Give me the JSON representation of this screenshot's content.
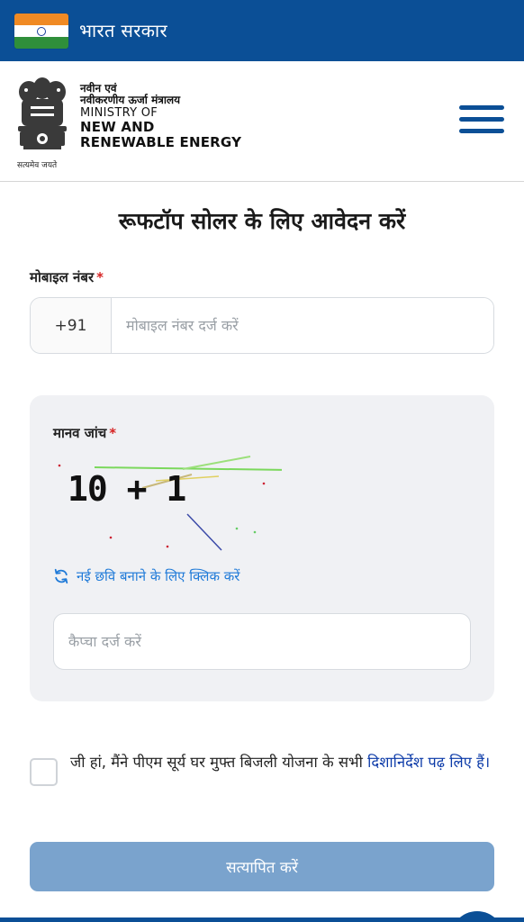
{
  "gov_bar": {
    "title": "भारत सरकार"
  },
  "header": {
    "emblem_caption": "सत्यमेव जयते",
    "ministry_hi_line1": "नवीन एवं",
    "ministry_hi_line2": "नवीकरणीय ऊर्जा मंत्रालय",
    "ministry_en_line1": "MINISTRY OF",
    "ministry_en_line2": "NEW AND",
    "ministry_en_line3": "RENEWABLE ENERGY",
    "menu_icon": "hamburger-icon"
  },
  "form": {
    "title": "रूफटॉप सोलर के लिए आवेदन करें",
    "mobile": {
      "label": "मोबाइल नंबर",
      "required_mark": "*",
      "prefix": "+91",
      "placeholder": "मोबाइल नंबर दर्ज करें",
      "value": ""
    },
    "captcha": {
      "label": "मानव जांच",
      "required_mark": "*",
      "image_text": "10 + 1",
      "refresh_icon": "refresh-icon",
      "refresh_label": "नई छवि बनाने के लिए क्लिक करें",
      "placeholder": "कैप्चा दर्ज करें",
      "value": ""
    },
    "agreement": {
      "checked": false,
      "text": "जी हां, मैंने पीएम सूर्य घर मुफ्त बिजली योजना के सभी ",
      "link_text": "दिशानिर्देश पढ़ लिए हैं।"
    },
    "submit_label": "सत्यापित करें"
  },
  "colors": {
    "primary": "#0b4f96",
    "button_disabled": "#7aa3cd",
    "link": "#0b3aa8",
    "refresh_link": "#1f7ad8",
    "required": "#d62222"
  }
}
